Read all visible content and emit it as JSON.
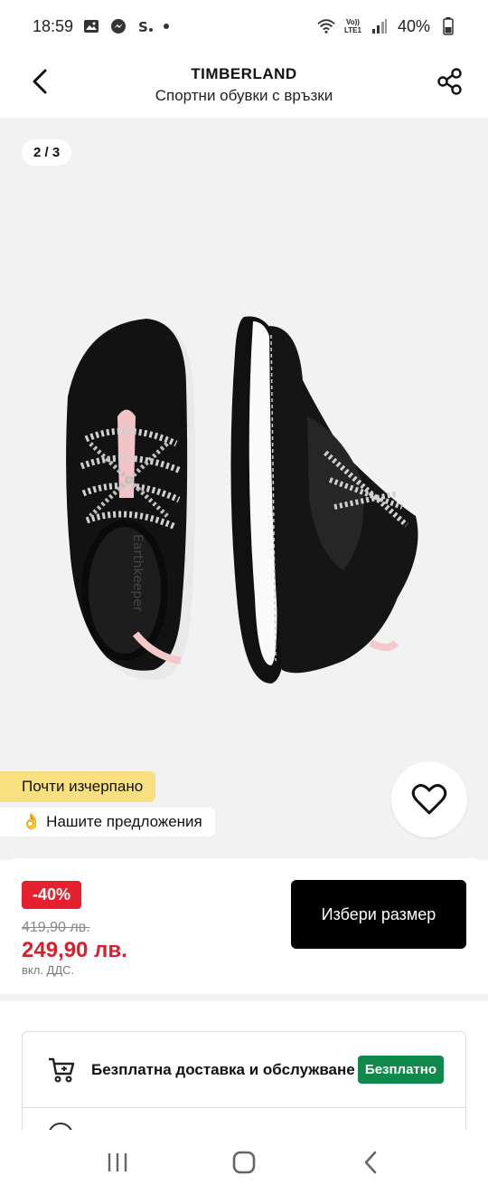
{
  "status_bar": {
    "time": "18:59",
    "battery": "40%",
    "network_label": "Vo))\nLTE1"
  },
  "header": {
    "brand": "TIMBERLAND",
    "subtitle": "Спортни обувки с връзки"
  },
  "gallery": {
    "counter": "2 / 3",
    "low_stock_label": "Почти изчерпано",
    "offers_emoji": "👌",
    "offers_label": "Нашите предложения"
  },
  "price": {
    "discount": "-40%",
    "old_price": "419,90 лв.",
    "new_price": "249,90 лв.",
    "vat_note": "вкл. ДДС.",
    "select_size_label": "Избери размер"
  },
  "delivery": {
    "title": "Безплатна доставка и обслужване",
    "badge": "Безплатно"
  },
  "colors": {
    "accent_red": "#e5212f",
    "price_red": "#d8202c",
    "badge_green": "#108a4a",
    "low_stock_yellow": "#f8e081"
  },
  "icons": [
    "back-arrow-icon",
    "share-icon",
    "heart-icon",
    "cart-icon",
    "recent-apps-icon",
    "home-icon",
    "nav-back-icon"
  ]
}
